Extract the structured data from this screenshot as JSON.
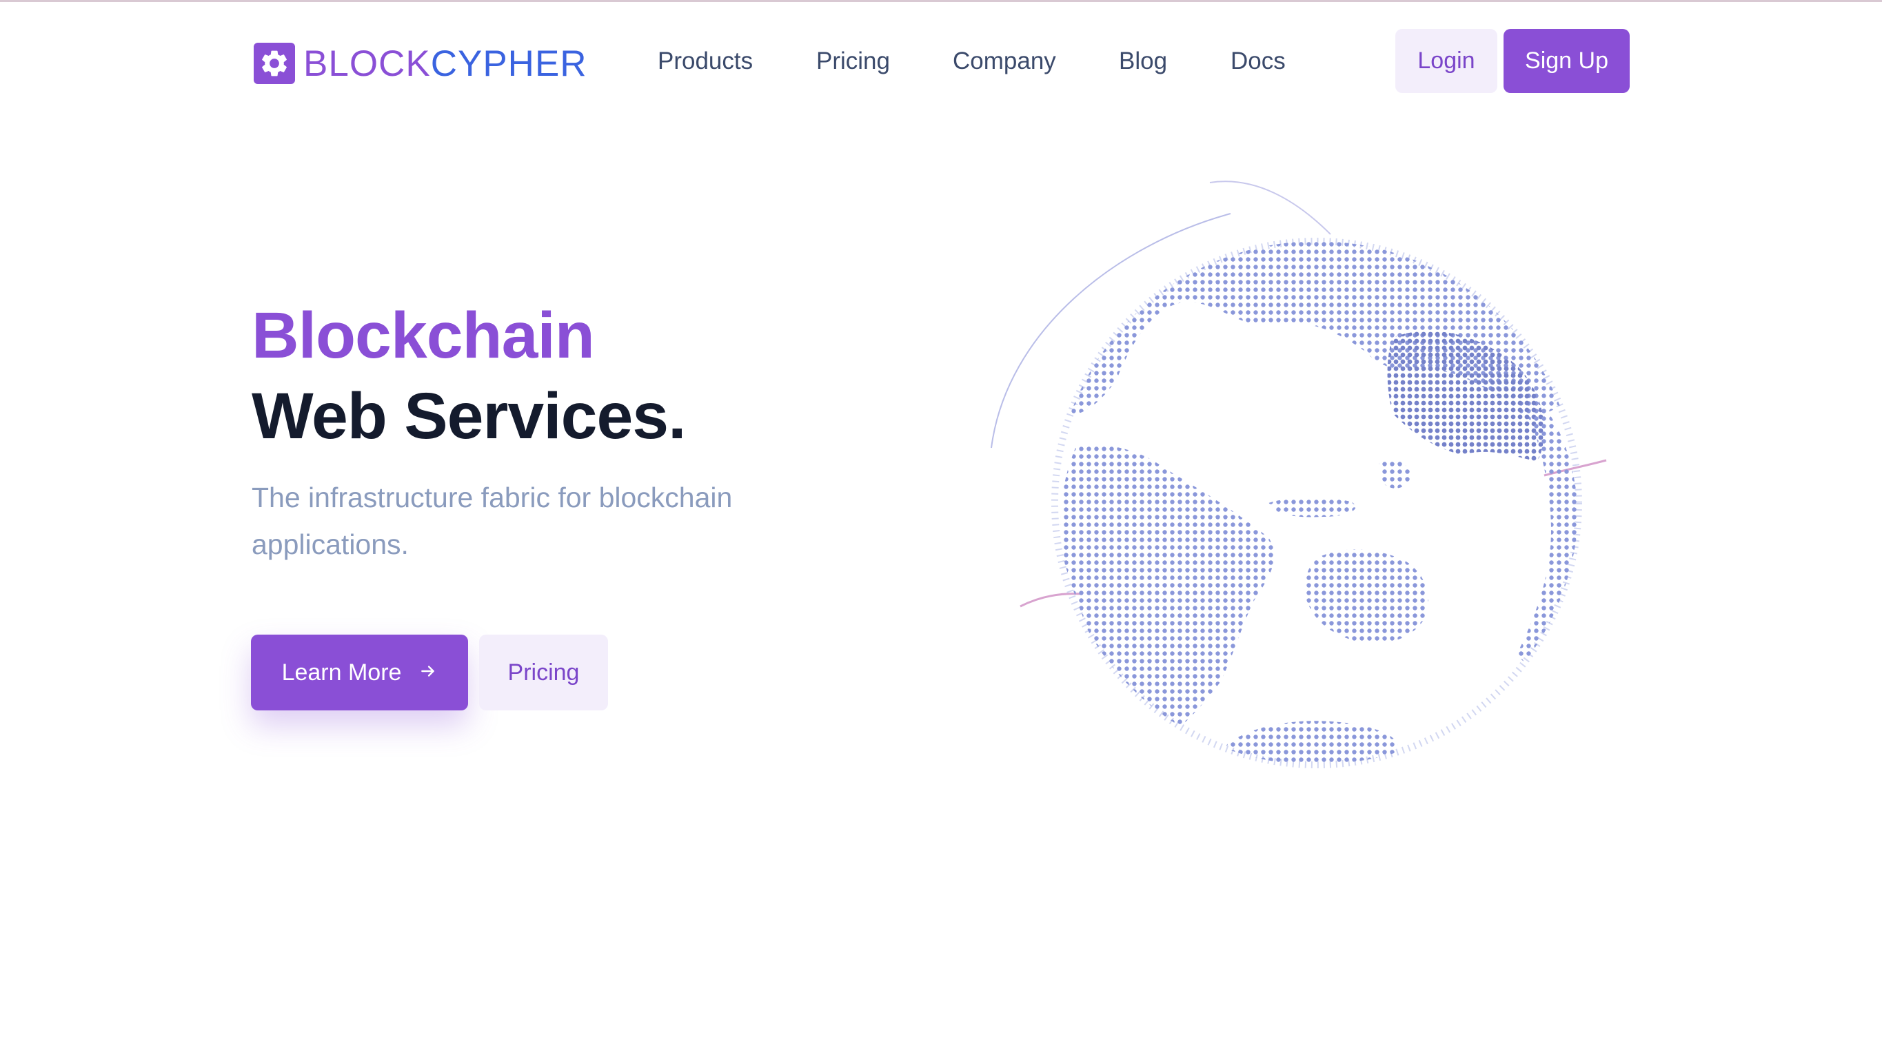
{
  "brand": {
    "name_part_1": "BLOCK",
    "name_part_2": "CYPHER",
    "primary_color": "#8a4fd6",
    "secondary_color": "#3a63e0"
  },
  "nav": {
    "items": [
      {
        "label": "Products"
      },
      {
        "label": "Pricing"
      },
      {
        "label": "Company"
      },
      {
        "label": "Blog"
      },
      {
        "label": "Docs"
      }
    ],
    "login_label": "Login",
    "signup_label": "Sign Up"
  },
  "hero": {
    "title_line_1": "Blockchain",
    "title_line_2": "Web Services.",
    "subtitle": "The infrastructure fabric for blockchain applications.",
    "learn_more_label": "Learn More",
    "learn_more_icon": "arrow-right-icon",
    "pricing_label": "Pricing",
    "illustration_icon": "globe-icon"
  }
}
